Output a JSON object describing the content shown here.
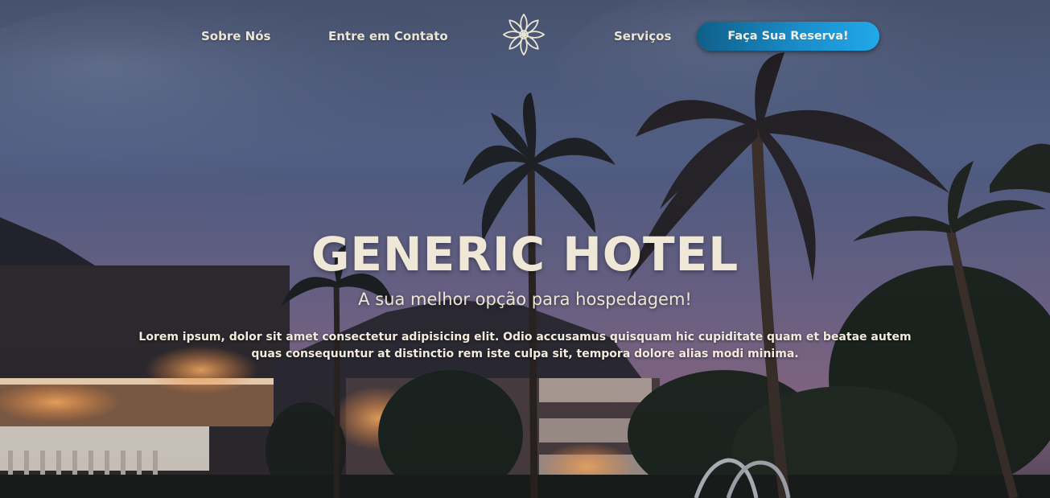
{
  "nav": {
    "about_label": "Sobre Nós",
    "contact_label": "Entre em Contato",
    "services_label": "Serviços",
    "cta_label": "Faça Sua Reserva!",
    "logo_icon": "lotus-flower-icon"
  },
  "hero": {
    "title": "GENERIC HOTEL",
    "subtitle": "A sua melhor opção para hospedagem!",
    "description": "Lorem ipsum, dolor sit amet consectetur adipisicing elit. Odio accusamus quisquam hic cupiditate quam et beatae autem quas consequuntur at distinctio rem iste culpa sit, tempora dolore alias modi minima."
  },
  "colors": {
    "text": "#ece5d3",
    "cta_start": "#0f5f88",
    "cta_end": "#22a8e8",
    "sky_top": "#5f6f93",
    "sky_bottom": "#8a6a86"
  }
}
